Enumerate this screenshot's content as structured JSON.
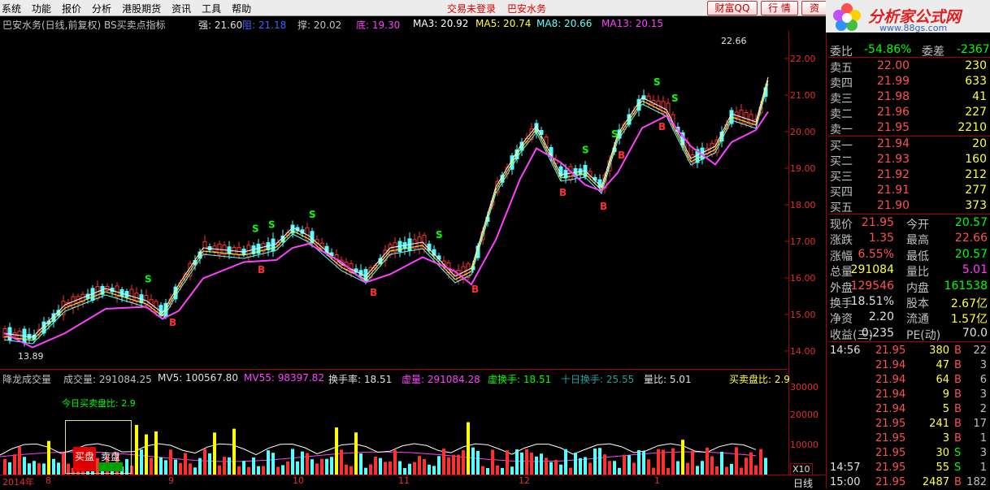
{
  "menu": [
    "系统",
    "功能",
    "报价",
    "分析",
    "港股期货",
    "资讯",
    "工具",
    "帮助"
  ],
  "top_status": {
    "login": "交易未登录",
    "stock": "巴安水务"
  },
  "top_buttons": {
    "qq": "财富QQ",
    "quote": "行 情",
    "trade": "资"
  },
  "logo": {
    "name": "分析家公式网",
    "url": "www.88gs.com"
  },
  "kline_info": {
    "title": "巴安水务(日线,前复权) BS买卖点指标",
    "strong": "强: 21.60",
    "resist": "阻: 21.18",
    "support": "撑: 20.02",
    "bottom": "底: 19.30",
    "ma3": "MA3: 20.92",
    "ma5": "MA5: 20.74",
    "ma8": "MA8: 20.66",
    "ma13": "MA13: 20.15"
  },
  "chart_marks": {
    "high": "22.66",
    "low": "13.89"
  },
  "price_axis": [
    "22.00",
    "21.00",
    "20.00",
    "19.00",
    "18.00",
    "17.00",
    "16.00",
    "15.00",
    "14.00"
  ],
  "volume_info": {
    "title": "降龙成交量",
    "vol": "成交量: 291084.25",
    "mv5": "MV5: 100567.80",
    "mv55": "MV55: 98397.82",
    "turnover": "换手率: 18.51",
    "xvol": "虚量: 291084.28",
    "xturn": "虚换手: 18.51",
    "ten": "十日换手: 25.55",
    "ratio": "量比: 5.01",
    "bs": "买卖盘比: 2.9"
  },
  "volume_axis": [
    "30000",
    "20000",
    "10000"
  ],
  "volume_unit": "X10",
  "today_ratio": "今日买卖盘比: 2.9",
  "legend": {
    "buy": "买盘",
    "sell": "卖盘"
  },
  "x_labels": [
    "2014年",
    "8",
    "9",
    "10",
    "11",
    "12",
    "1"
  ],
  "period": "日线",
  "right_panel": {
    "header": {
      "label": "委比",
      "value": "-54.86%",
      "label2": "委差",
      "value2": "-2367"
    },
    "asks": [
      {
        "label": "卖五",
        "price": "22.00",
        "vol": "230"
      },
      {
        "label": "卖四",
        "price": "21.99",
        "vol": "633"
      },
      {
        "label": "卖三",
        "price": "21.98",
        "vol": "41"
      },
      {
        "label": "卖二",
        "price": "21.96",
        "vol": "227"
      },
      {
        "label": "卖一",
        "price": "21.95",
        "vol": "2210"
      }
    ],
    "bids": [
      {
        "label": "买一",
        "price": "21.94",
        "vol": "20"
      },
      {
        "label": "买二",
        "price": "21.93",
        "vol": "160"
      },
      {
        "label": "买三",
        "price": "21.92",
        "vol": "212"
      },
      {
        "label": "买四",
        "price": "21.91",
        "vol": "277"
      },
      {
        "label": "买五",
        "price": "21.90",
        "vol": "373"
      }
    ],
    "stats": [
      {
        "l1": "现价",
        "v1": "21.95",
        "l2": "今开",
        "v2": "20.57"
      },
      {
        "l1": "涨跌",
        "v1": "1.35",
        "l2": "最高",
        "v2": "22.66"
      },
      {
        "l1": "涨幅",
        "v1": "6.55%",
        "l2": "最低",
        "v2": "20.57"
      },
      {
        "l1": "总量",
        "v1": "291084",
        "l2": "量比",
        "v2": "5.01"
      },
      {
        "l1": "外盘",
        "v1": "129546",
        "l2": "内盘",
        "v2": "161538"
      },
      {
        "l1": "换手",
        "v1": "18.51%",
        "l2": "股本",
        "v2": "2.67亿"
      },
      {
        "l1": "净资",
        "v1": "2.20",
        "l2": "流通",
        "v2": "1.57亿"
      },
      {
        "l1": "收益(三)",
        "v1": "0.235",
        "l2": "PE(动)",
        "v2": "70.0"
      }
    ],
    "ticks": [
      {
        "time": "14:56",
        "price": "21.95",
        "vol": "380",
        "bs": "B",
        "n": "22"
      },
      {
        "time": "",
        "price": "21.94",
        "vol": "47",
        "bs": "B",
        "n": "3"
      },
      {
        "time": "",
        "price": "21.94",
        "vol": "64",
        "bs": "B",
        "n": "6"
      },
      {
        "time": "",
        "price": "21.94",
        "vol": "9",
        "bs": "B",
        "n": "3"
      },
      {
        "time": "",
        "price": "21.94",
        "vol": "5",
        "bs": "B",
        "n": "2"
      },
      {
        "time": "",
        "price": "21.95",
        "vol": "241",
        "bs": "B",
        "n": "17"
      },
      {
        "time": "",
        "price": "21.95",
        "vol": "3",
        "bs": "B",
        "n": "1"
      },
      {
        "time": "",
        "price": "21.95",
        "vol": "30",
        "bs": "S",
        "n": "3"
      },
      {
        "time": "14:57",
        "price": "21.95",
        "vol": "55",
        "bs": "S",
        "n": "1"
      },
      {
        "time": "15:00",
        "price": "21.95",
        "vol": "2487",
        "bs": "B",
        "n": "182"
      }
    ]
  },
  "colors": {
    "up": "#ff3030",
    "down": "#54ffff",
    "ma_purple": "#ff40ff",
    "grid": "#800000",
    "yellow": "#ffff00",
    "green": "#00ff00",
    "bid_red": "#ff5050"
  }
}
